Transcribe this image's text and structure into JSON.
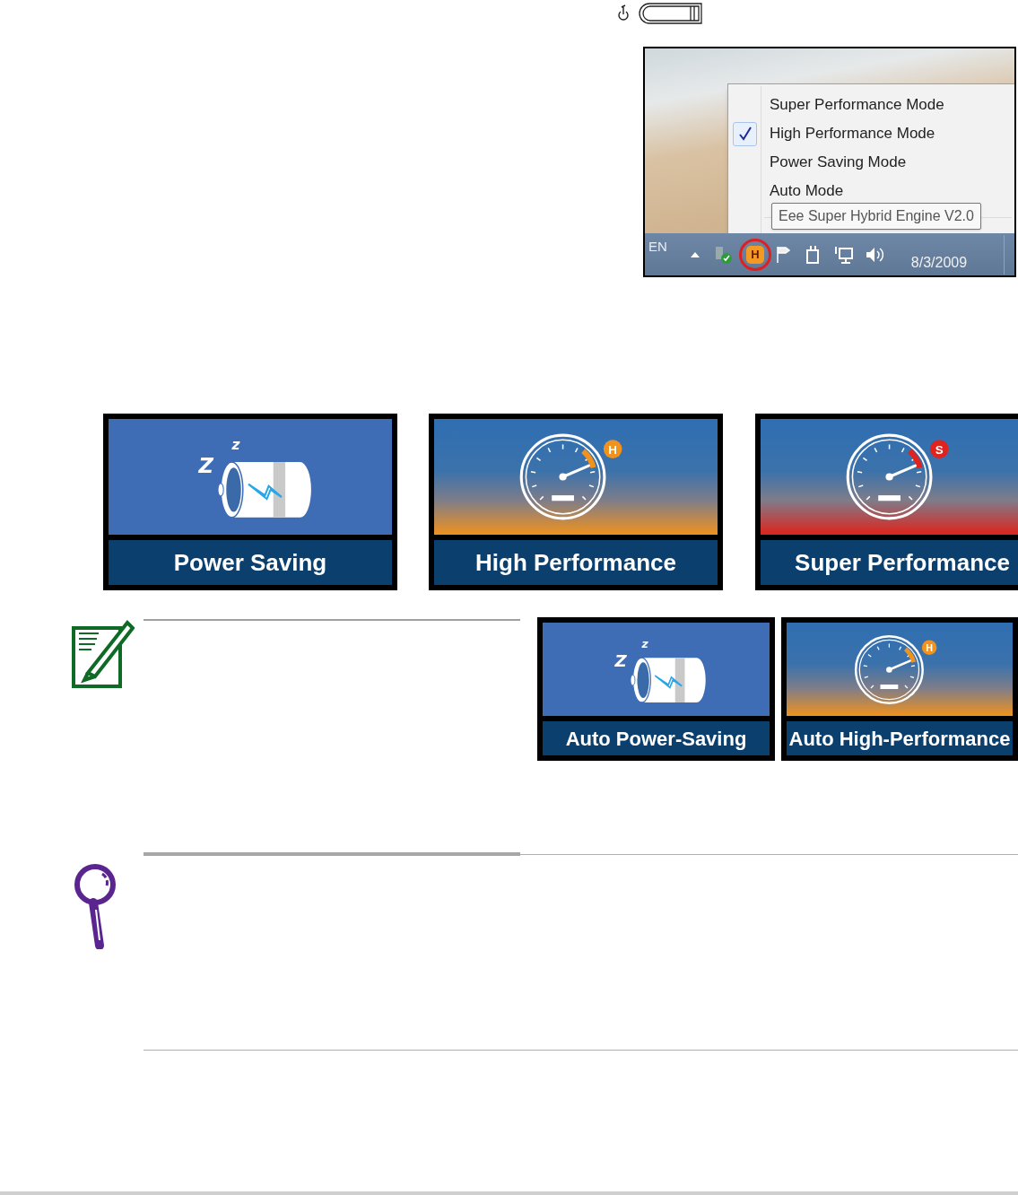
{
  "tray_screenshot": {
    "menu_items": [
      {
        "label": "Super Performance Mode",
        "checked": false
      },
      {
        "label": "High Performance Mode",
        "checked": true
      },
      {
        "label": "Power Saving Mode",
        "checked": false
      },
      {
        "label": "Auto Mode",
        "checked": false
      }
    ],
    "tooltip": "Eee Super Hybrid Engine V2.0",
    "taskbar": {
      "language": "EN",
      "app_icon_letter": "H",
      "date": "8/3/2009"
    }
  },
  "mode_tiles": [
    {
      "kind": "battery",
      "label": "Power Saving",
      "sleep_marks": [
        "Z",
        "z"
      ]
    },
    {
      "kind": "gauge",
      "label": "High Performance",
      "badge": "H",
      "color": "#f0921e"
    },
    {
      "kind": "gauge",
      "label": "Super Performance",
      "badge": "S",
      "color": "#e0231c"
    }
  ],
  "auto_tiles": [
    {
      "kind": "battery",
      "label": "Auto Power-Saving",
      "sleep_marks": [
        "Z",
        "z"
      ]
    },
    {
      "kind": "gauge",
      "label": "Auto High-Performance",
      "badge": "H",
      "color": "#f0921e"
    }
  ]
}
